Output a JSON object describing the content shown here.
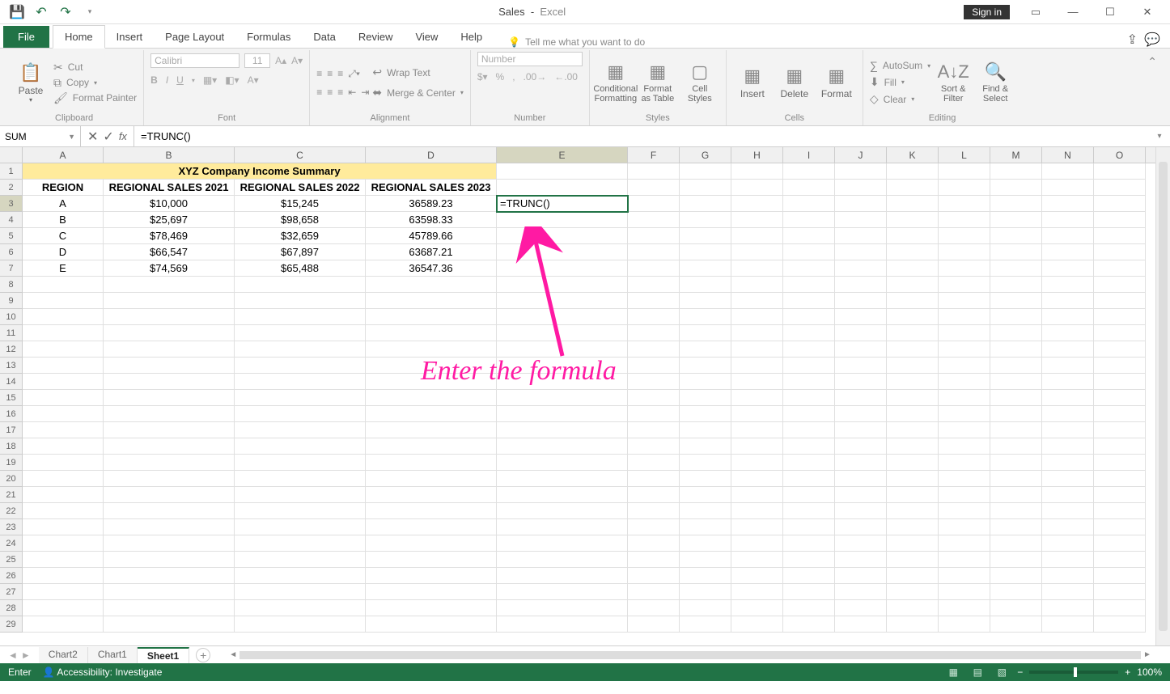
{
  "title": {
    "doc": "Sales",
    "app": "Excel"
  },
  "signin": "Sign in",
  "ribbon_tabs": [
    "File",
    "Home",
    "Insert",
    "Page Layout",
    "Formulas",
    "Data",
    "Review",
    "View",
    "Help"
  ],
  "tellme": "Tell me what you want to do",
  "groups": {
    "clipboard": {
      "label": "Clipboard",
      "paste": "Paste",
      "cut": "Cut",
      "copy": "Copy",
      "fmtpainter": "Format Painter"
    },
    "font": {
      "label": "Font",
      "name": "Calibri",
      "size": "11"
    },
    "alignment": {
      "label": "Alignment",
      "wrap": "Wrap Text",
      "merge": "Merge & Center"
    },
    "number": {
      "label": "Number",
      "fmt": "Number"
    },
    "styles": {
      "label": "Styles",
      "cond": "Conditional Formatting",
      "table": "Format as Table",
      "cell": "Cell Styles"
    },
    "cells": {
      "label": "Cells",
      "insert": "Insert",
      "delete": "Delete",
      "format": "Format"
    },
    "editing": {
      "label": "Editing",
      "autosum": "AutoSum",
      "fill": "Fill",
      "clear": "Clear",
      "sort": "Sort & Filter",
      "find": "Find & Select"
    }
  },
  "name_box": "SUM",
  "formula": "=TRUNC()",
  "columns": [
    "A",
    "B",
    "C",
    "D",
    "E",
    "F",
    "G",
    "H",
    "I",
    "J",
    "K",
    "L",
    "M",
    "N",
    "O"
  ],
  "col_widths": [
    "cA",
    "cB",
    "cC",
    "cD",
    "cE",
    "cX",
    "cX",
    "cX",
    "cX",
    "cX",
    "cX",
    "cX",
    "cX",
    "cX",
    "cX"
  ],
  "active_col": "E",
  "active_row": 3,
  "max_row": 29,
  "data": {
    "merged_header": {
      "text": "XYZ Company Income Summary",
      "row": 1,
      "span": 4
    },
    "headers": {
      "row": 2,
      "A": "REGION",
      "B": "REGIONAL SALES 2021",
      "C": "REGIONAL SALES 2022",
      "D": "REGIONAL SALES 2023"
    },
    "rows": [
      {
        "r": 3,
        "A": "A",
        "B": "$10,000",
        "C": "$15,245",
        "D": "36589.23",
        "E": "=TRUNC()"
      },
      {
        "r": 4,
        "A": "B",
        "B": "$25,697",
        "C": "$98,658",
        "D": "63598.33"
      },
      {
        "r": 5,
        "A": "C",
        "B": "$78,469",
        "C": "$32,659",
        "D": "45789.66"
      },
      {
        "r": 6,
        "A": "D",
        "B": "$66,547",
        "C": "$67,897",
        "D": "63687.21"
      },
      {
        "r": 7,
        "A": "E",
        "B": "$74,569",
        "C": "$65,488",
        "D": "36547.36"
      }
    ]
  },
  "sheet_tabs": [
    "Chart2",
    "Chart1",
    "Sheet1"
  ],
  "active_sheet": "Sheet1",
  "status": {
    "mode": "Enter",
    "access": "Accessibility: Investigate",
    "zoom": "100%"
  },
  "annotation": "Enter the formula"
}
